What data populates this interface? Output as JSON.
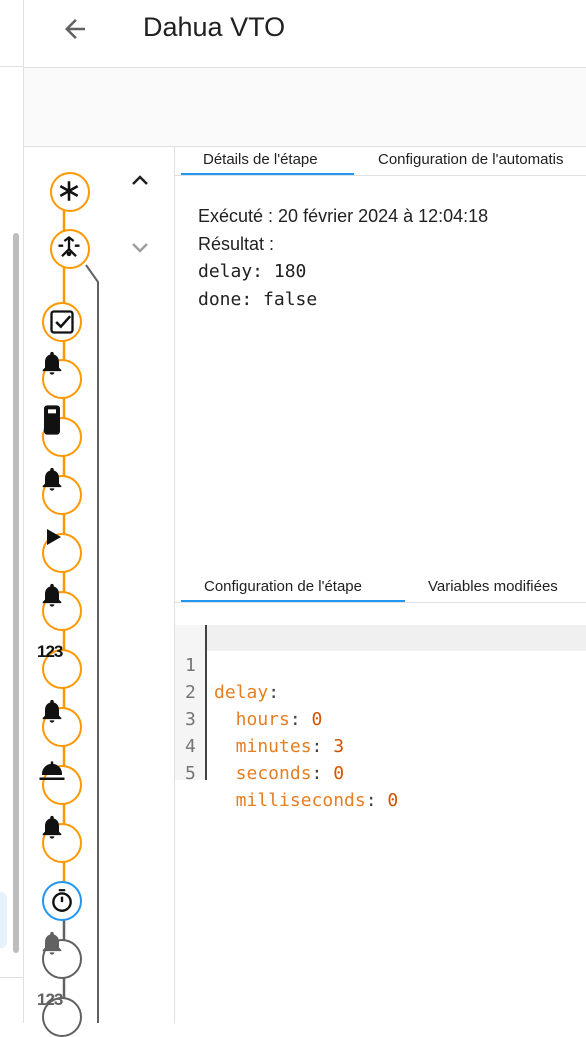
{
  "header": {
    "title": "Dahua VTO",
    "back_icon": "arrow-left-icon"
  },
  "trace": {
    "nav_up_icon": "chevron-up-icon",
    "nav_down_icon": "chevron-down-icon",
    "nodes": [
      {
        "icon": "asterisk-icon",
        "color": "#ff9800"
      },
      {
        "icon": "call-split-icon",
        "color": "#ff9800"
      },
      {
        "icon": "checkbox-icon",
        "color": "#ff9800"
      },
      {
        "icon": "bell-icon",
        "color": "#ff9800"
      },
      {
        "icon": "doorbell-icon",
        "color": "#ff9800"
      },
      {
        "icon": "bell-icon",
        "color": "#ff9800"
      },
      {
        "icon": "play-icon",
        "color": "#ff9800"
      },
      {
        "icon": "bell-icon",
        "color": "#ff9800"
      },
      {
        "icon": "numeric-icon",
        "label": "123",
        "color": "#ff9800"
      },
      {
        "icon": "bell-icon",
        "color": "#ff9800"
      },
      {
        "icon": "room-service-icon",
        "color": "#ff9800"
      },
      {
        "icon": "bell-icon",
        "color": "#ff9800"
      },
      {
        "icon": "timer-icon",
        "color": "#2196f3"
      },
      {
        "icon": "bell-icon",
        "color": "#616161"
      },
      {
        "icon": "numeric-icon",
        "label": "123",
        "color": "#616161"
      }
    ]
  },
  "details": {
    "tabs": [
      "Détails de l'étape",
      "Configuration de l'automatis"
    ],
    "executed": "Exécuté : 20 février 2024 à 12:04:18",
    "result_label": "Résultat :",
    "result_lines": [
      "delay: 180",
      "done: false"
    ]
  },
  "config": {
    "tabs": [
      "Configuration de l'étape",
      "Variables modifiées"
    ],
    "code": [
      {
        "n": "1",
        "key": "delay",
        "sep": ":",
        "val": ""
      },
      {
        "n": "2",
        "key": "  hours",
        "sep": ": ",
        "val": "0"
      },
      {
        "n": "3",
        "key": "  minutes",
        "sep": ": ",
        "val": "3"
      },
      {
        "n": "4",
        "key": "  seconds",
        "sep": ": ",
        "val": "0"
      },
      {
        "n": "5",
        "key": "  milliseconds",
        "sep": ": ",
        "val": "0"
      }
    ]
  }
}
